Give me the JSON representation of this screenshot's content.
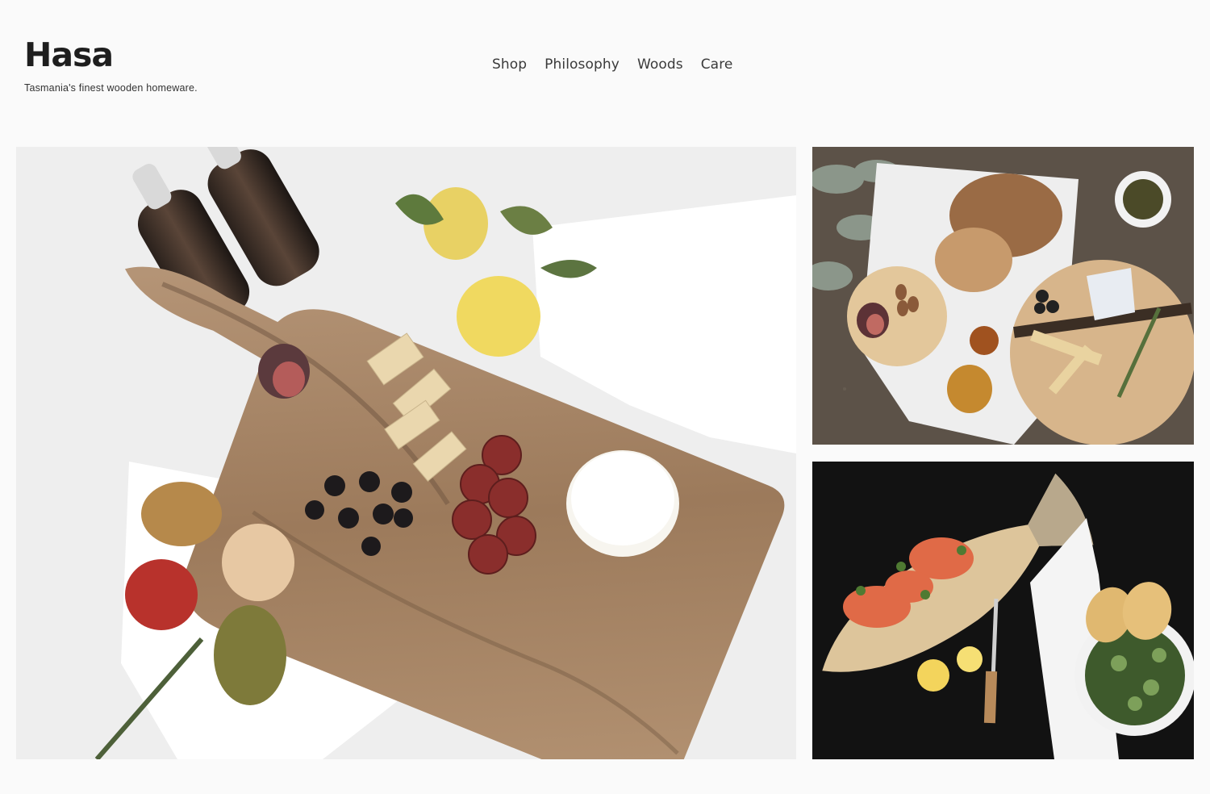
{
  "site": {
    "brand": "Hasa",
    "tagline": "Tasmania's finest wooden homeware."
  },
  "nav": {
    "items": [
      {
        "label": "Shop"
      },
      {
        "label": "Philosophy"
      },
      {
        "label": "Woods"
      },
      {
        "label": "Care"
      }
    ]
  },
  "gallery": {
    "items": [
      {
        "subject": "paddle-cheese-board-with-figs-crackers-salami-brie-berries-pears-and-bottles"
      },
      {
        "subject": "round-boards-with-bread-almonds-fig-blue-cheese-and-olives-on-concrete"
      },
      {
        "subject": "fish-shaped-board-with-smoked-salmon-lemons-knife-and-salad-bowl"
      }
    ]
  },
  "colors": {
    "background": "#fafafa",
    "text": "#2b2b2b",
    "wood": "#a78565"
  }
}
